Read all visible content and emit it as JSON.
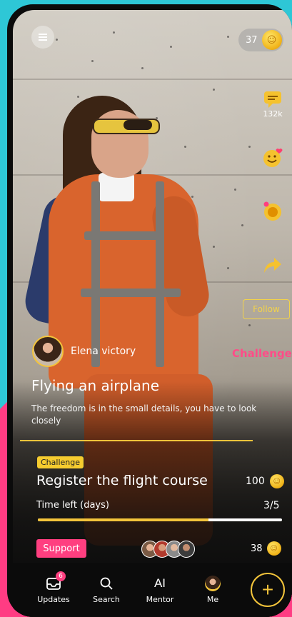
{
  "header": {
    "coins": "37"
  },
  "side": {
    "comments_count": "132k",
    "follow_label": "Follow"
  },
  "post": {
    "author_name": "Elena victory",
    "tag": "Challenge",
    "title": "Flying an airplane",
    "description": "The freedom is in the small details, you have to look closely"
  },
  "panel": {
    "label": "Challenge",
    "title": "Register the flight course",
    "coins": "100",
    "time_label": "Time left (days)",
    "time_value": "3/5",
    "time_progress": 0.7,
    "support_label": "Support",
    "support_count": "38"
  },
  "tabs": {
    "updates_label": "Updates",
    "updates_badge": "6",
    "search_label": "Search",
    "mentor_label": "Mentor",
    "mentor_glyph": "AI",
    "me_label": "Me",
    "plus": "+"
  },
  "colors": {
    "accent": "#f3c43b",
    "pink": "#ff3f80"
  }
}
